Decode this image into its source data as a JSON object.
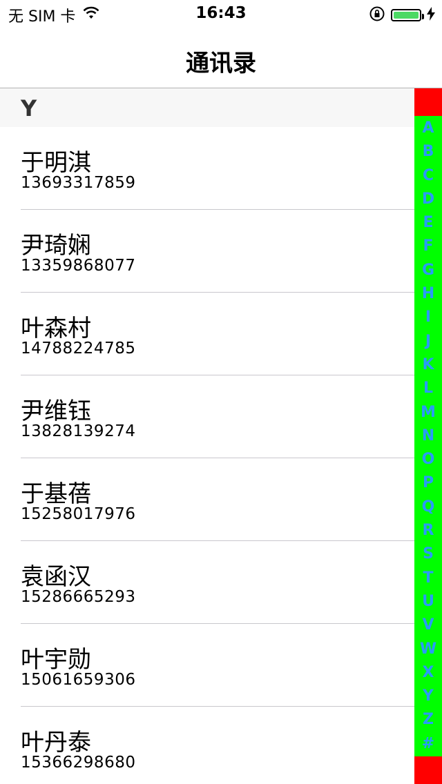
{
  "status_bar": {
    "carrier": "无 SIM 卡",
    "time": "16:43",
    "battery_level": 1.0,
    "battery_color": "#4cd964",
    "icons": [
      "wifi-icon",
      "rotation-lock-icon",
      "battery-icon",
      "charging-bolt-icon"
    ]
  },
  "nav": {
    "title": "通讯录"
  },
  "section": {
    "title": "Y"
  },
  "contacts": [
    {
      "name": "于明淇",
      "phone": "13693317859"
    },
    {
      "name": "尹琦娴",
      "phone": "13359868077"
    },
    {
      "name": "叶森村",
      "phone": "14788224785"
    },
    {
      "name": "尹维钰",
      "phone": "13828139274"
    },
    {
      "name": "于基蓓",
      "phone": "15258017976"
    },
    {
      "name": "袁函汉",
      "phone": "15286665293"
    },
    {
      "name": "叶宇勋",
      "phone": "15061659306"
    },
    {
      "name": "叶丹泰",
      "phone": "15366298680"
    }
  ],
  "index": {
    "letters": [
      "A",
      "B",
      "C",
      "D",
      "E",
      "F",
      "G",
      "H",
      "I",
      "J",
      "K",
      "L",
      "M",
      "N",
      "O",
      "P",
      "Q",
      "R",
      "S",
      "T",
      "U",
      "V",
      "W",
      "X",
      "Y",
      "Z",
      "#"
    ],
    "colors": {
      "bar": "#00ff00",
      "caps": "#ff0000",
      "letter": "#2a9af7"
    }
  }
}
